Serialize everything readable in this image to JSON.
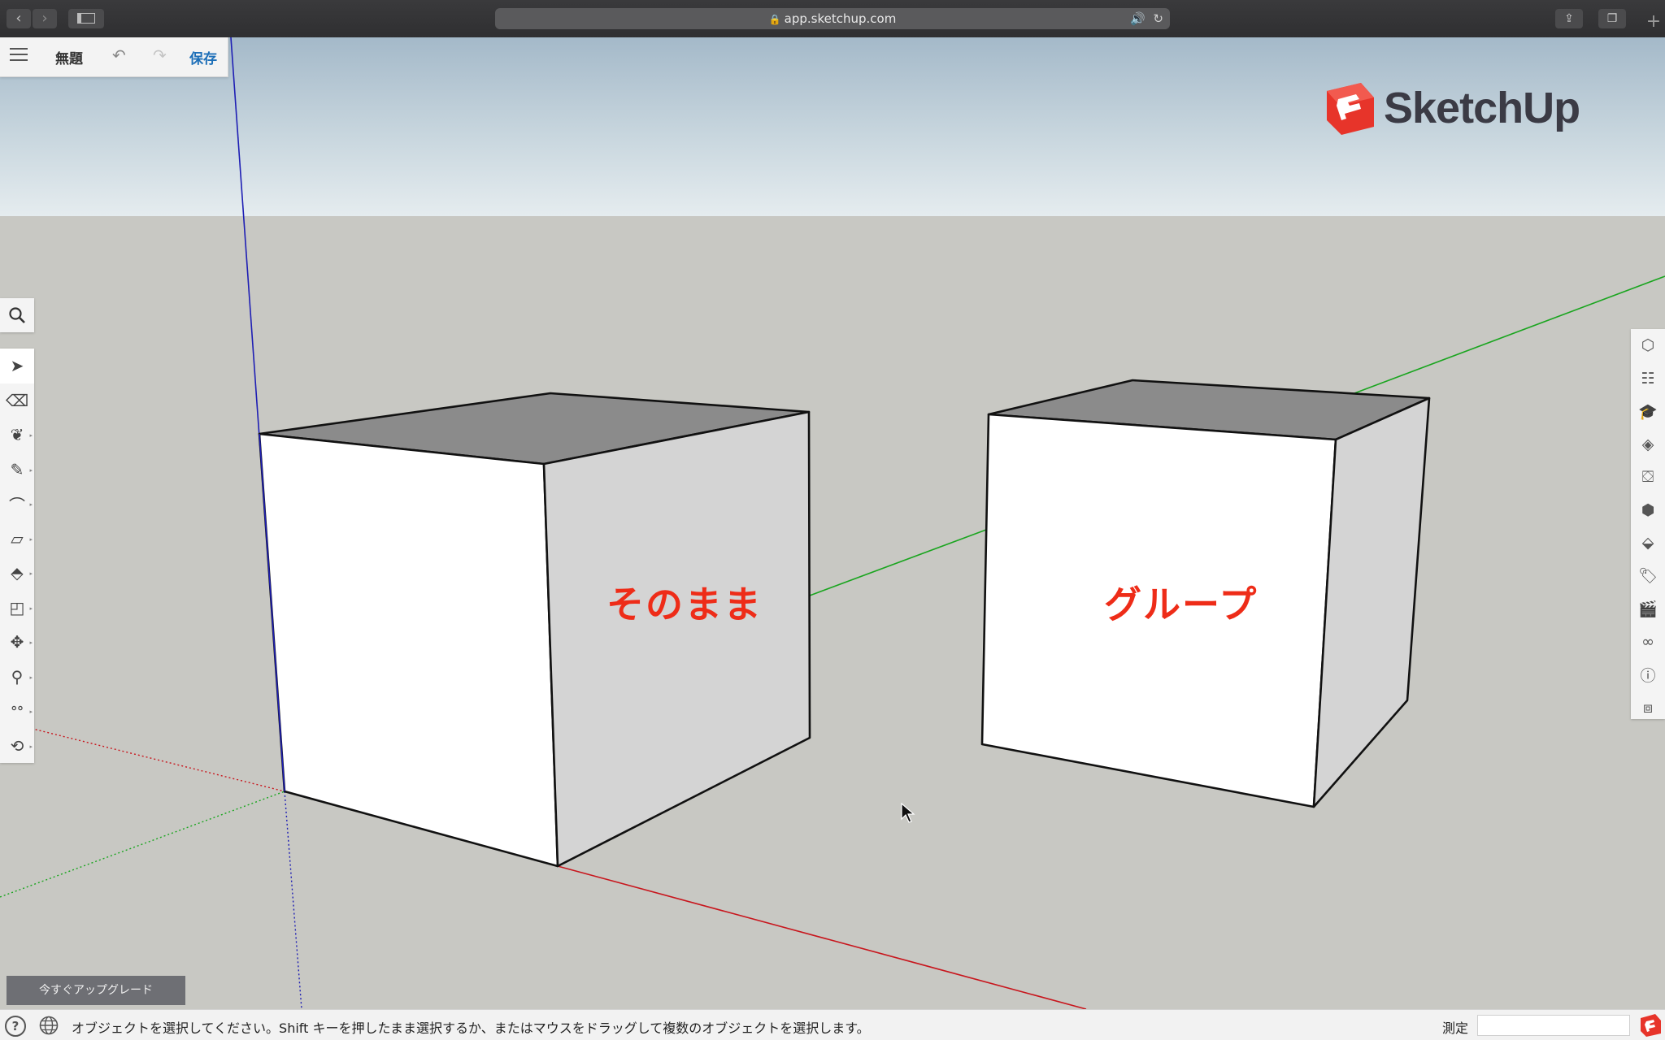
{
  "browser": {
    "url": "app.sketchup.com",
    "back_icon": "chevron-left-icon",
    "forward_icon": "chevron-right-icon",
    "sidebar_icon": "sidebar-icon",
    "audio_icon": "speaker-icon",
    "reload_icon": "reload-icon",
    "share_icon": "share-icon",
    "tabs_icon": "tabs-icon",
    "newtab_icon": "plus-icon"
  },
  "filebar": {
    "title": "無題",
    "save_label": "保存"
  },
  "logo": {
    "text": "SketchUp",
    "brand_color": "#e7342a"
  },
  "left_tools": [
    "select",
    "eraser",
    "paint",
    "pencil",
    "arc",
    "rectangle",
    "push-pull",
    "offset",
    "move",
    "tape-measure",
    "walk",
    "orbit"
  ],
  "right_tools": [
    "styles",
    "outliner",
    "instructor",
    "materials",
    "components",
    "entity-info",
    "solid-tools",
    "tags",
    "scenes",
    "display",
    "model-info",
    "3d-warehouse"
  ],
  "scene": {
    "left_face_label": "そのまま",
    "right_face_label": "グループ",
    "label_color": "#ee2c18",
    "axis_colors": {
      "x": "#c8161d",
      "y": "#1aa51f",
      "z": "#1e1eb4"
    }
  },
  "upgrade_label": "今すぐアップグレード",
  "status": {
    "message": "オブジェクトを選択してください。Shift キーを押したまま選択するか、またはマウスをドラッグして複数のオブジェクトを選択します。",
    "measure_label": "測定",
    "measure_value": ""
  }
}
